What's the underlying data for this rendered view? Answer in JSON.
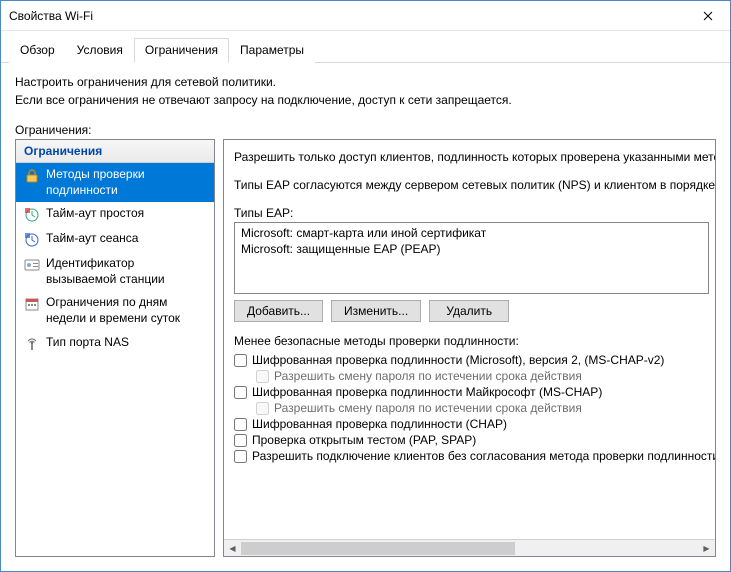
{
  "window": {
    "title": "Свойства Wi-Fi"
  },
  "tabs": {
    "overview": "Обзор",
    "conditions": "Условия",
    "constraints": "Ограничения",
    "settings": "Параметры"
  },
  "instructions": {
    "line1": "Настроить ограничения для сетевой политики.",
    "line2": "Если все ограничения не отвечают запросу на подключение, доступ к сети запрещается."
  },
  "section_label": "Ограничения:",
  "sidebar": {
    "header": "Ограничения",
    "items": [
      {
        "label": "Методы проверки подлинности"
      },
      {
        "label": "Тайм-аут простоя"
      },
      {
        "label": "Тайм-аут сеанса"
      },
      {
        "label": "Идентификатор вызываемой станции"
      },
      {
        "label": "Ограничения по дням недели и времени суток"
      },
      {
        "label": "Тип порта NAS"
      }
    ]
  },
  "detail": {
    "allow_text": "Разрешить только доступ клиентов, подлинность которых проверена указанными методами.",
    "eap_order_text": "Типы EAP согласуются между сервером сетевых политик (NPS) и клиентом в порядке, в котором они указаны.",
    "eap_label": "Типы EAP:",
    "eap_items": [
      "Microsoft: смарт-карта или иной сертификат",
      "Microsoft: защищенные EAP (PEAP)"
    ],
    "buttons": {
      "add": "Добавить...",
      "edit": "Изменить...",
      "remove": "Удалить"
    },
    "less_secure_label": "Менее безопасные методы проверки подлинности:",
    "checks": {
      "mschapv2": "Шифрованная проверка подлинности (Microsoft), версия 2, (MS-CHAP-v2)",
      "mschapv2_sub": "Разрешить смену пароля по истечении срока действия",
      "mschap": "Шифрованная проверка подлинности Майкрософт (MS-CHAP)",
      "mschap_sub": "Разрешить смену пароля по истечении срока действия",
      "chap": "Шифрованная проверка подлинности (CHAP)",
      "pap": "Проверка открытым тестом (PAP, SPAP)",
      "noauth": "Разрешить подключение клиентов без согласования метода проверки подлинности"
    }
  }
}
